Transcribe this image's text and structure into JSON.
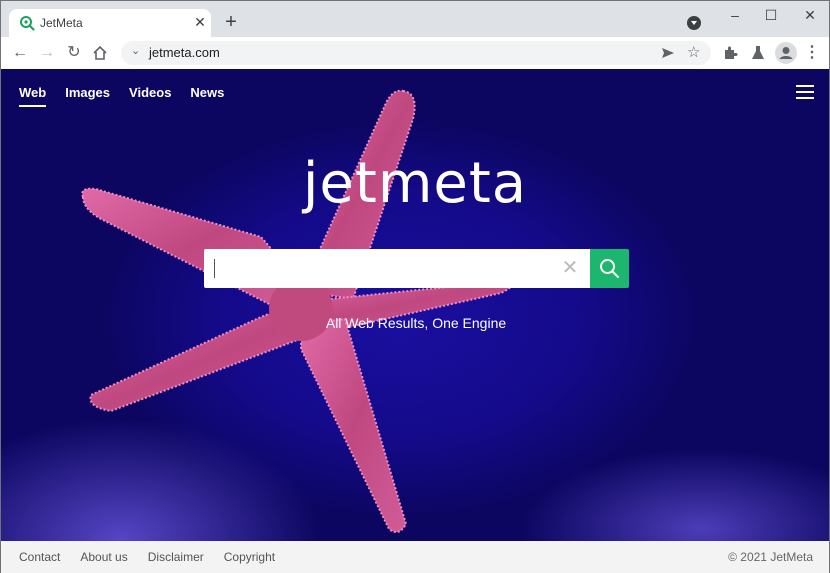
{
  "browser": {
    "tab": {
      "title": "JetMeta",
      "favicon": "search-icon",
      "close_icon": "close-icon"
    },
    "new_tab_icon": "plus-icon",
    "url": "jetmeta.com",
    "window_controls": {
      "minimize": "–",
      "maximize": "☐",
      "close": "✕"
    },
    "toolbar_icons": [
      "back-arrow-icon",
      "forward-arrow-icon",
      "reload-icon",
      "home-icon",
      "send-icon",
      "star-icon",
      "extensions-icon",
      "labs-icon",
      "profile-icon",
      "menu-kebab-icon"
    ]
  },
  "nav": {
    "items": [
      {
        "label": "Web",
        "active": true
      },
      {
        "label": "Images",
        "active": false
      },
      {
        "label": "Videos",
        "active": false
      },
      {
        "label": "News",
        "active": false
      }
    ],
    "menu_icon": "hamburger-icon"
  },
  "hero": {
    "logo": "jetmeta",
    "search": {
      "value": "",
      "placeholder": ""
    },
    "tagline": "All Web Results, One Engine",
    "accent_color": "#1db66e"
  },
  "footer": {
    "links": [
      "Contact",
      "About us",
      "Disclaimer",
      "Copyright"
    ],
    "copyright": "© 2021 JetMeta"
  }
}
